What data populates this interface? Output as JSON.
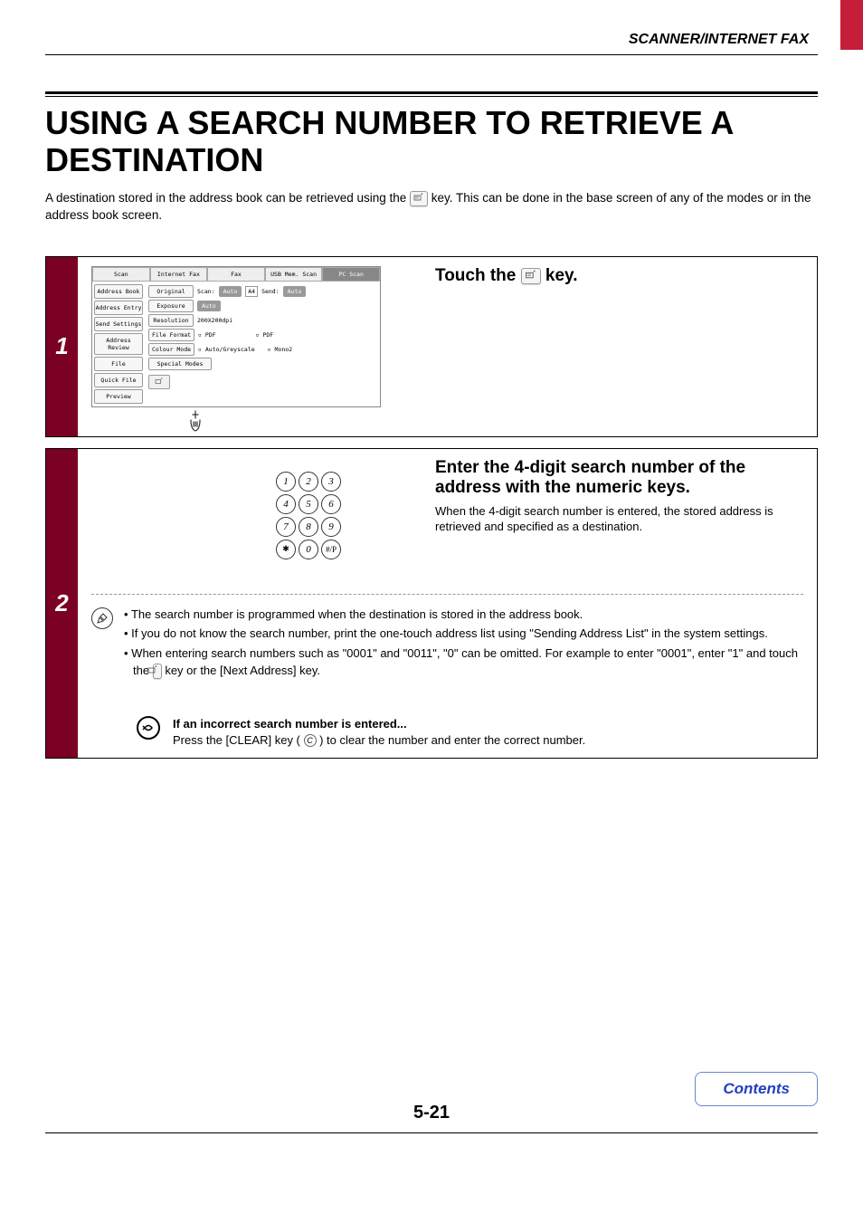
{
  "header": {
    "section": "SCANNER/INTERNET FAX"
  },
  "title": "USING A SEARCH NUMBER TO RETRIEVE A DESTINATION",
  "intro": {
    "part1": "A destination stored in the address book can be retrieved using the ",
    "part2": " key. This can be done in the base screen of any of the modes or in the address book screen."
  },
  "step1": {
    "num": "1",
    "instruction_pre": "Touch the ",
    "instruction_post": " key.",
    "screen": {
      "tabs": [
        "Scan",
        "Internet Fax",
        "Fax",
        "USB Mem. Scan",
        "PC Scan"
      ],
      "side": [
        "Address Book",
        "Address Entry",
        "Send Settings",
        "Address Review",
        "File",
        "Quick File",
        "Preview"
      ],
      "rows": {
        "original": {
          "label": "Original",
          "scan": "Scan:",
          "auto1": "Auto",
          "size": "A4",
          "send": "Send:",
          "auto2": "Auto"
        },
        "exposure": {
          "label": "Exposure",
          "val": "Auto"
        },
        "resolution": {
          "label": "Resolution",
          "val": "200X200dpi"
        },
        "fileformat": {
          "label": "File Format",
          "v1": "PDF",
          "v2": "PDF"
        },
        "colourmode": {
          "label": "Colour Mode",
          "v1": "Auto/Greyscale",
          "v2": "Mono2"
        },
        "special": {
          "label": "Special Modes"
        }
      }
    }
  },
  "step2": {
    "num": "2",
    "instruction": "Enter the 4-digit search number of the address with the numeric keys.",
    "subtext": "When the 4-digit search number is entered, the stored address is retrieved and specified as a destination.",
    "keys": [
      "1",
      "2",
      "3",
      "4",
      "5",
      "6",
      "7",
      "8",
      "9",
      "✱",
      "0",
      "#/P"
    ],
    "notes": [
      "The search number is programmed when the destination is stored in the address book.",
      "If you do not know the search number, print the one-touch address list using \"Sending Address List\" in the system settings.",
      "When entering search numbers such as \"0001\" and \"0011\", \"0\" can be omitted. For example to enter \"0001\", enter \"1\" and touch the "
    ],
    "note3_tail": " key or the [Next Address] key.",
    "undo": {
      "heading": "If an incorrect search number is entered...",
      "text_pre": "Press the [CLEAR] key ( ",
      "clear_glyph": "C",
      "text_post": " ) to clear the number and enter the correct number."
    }
  },
  "page_number": "5-21",
  "contents_label": "Contents"
}
